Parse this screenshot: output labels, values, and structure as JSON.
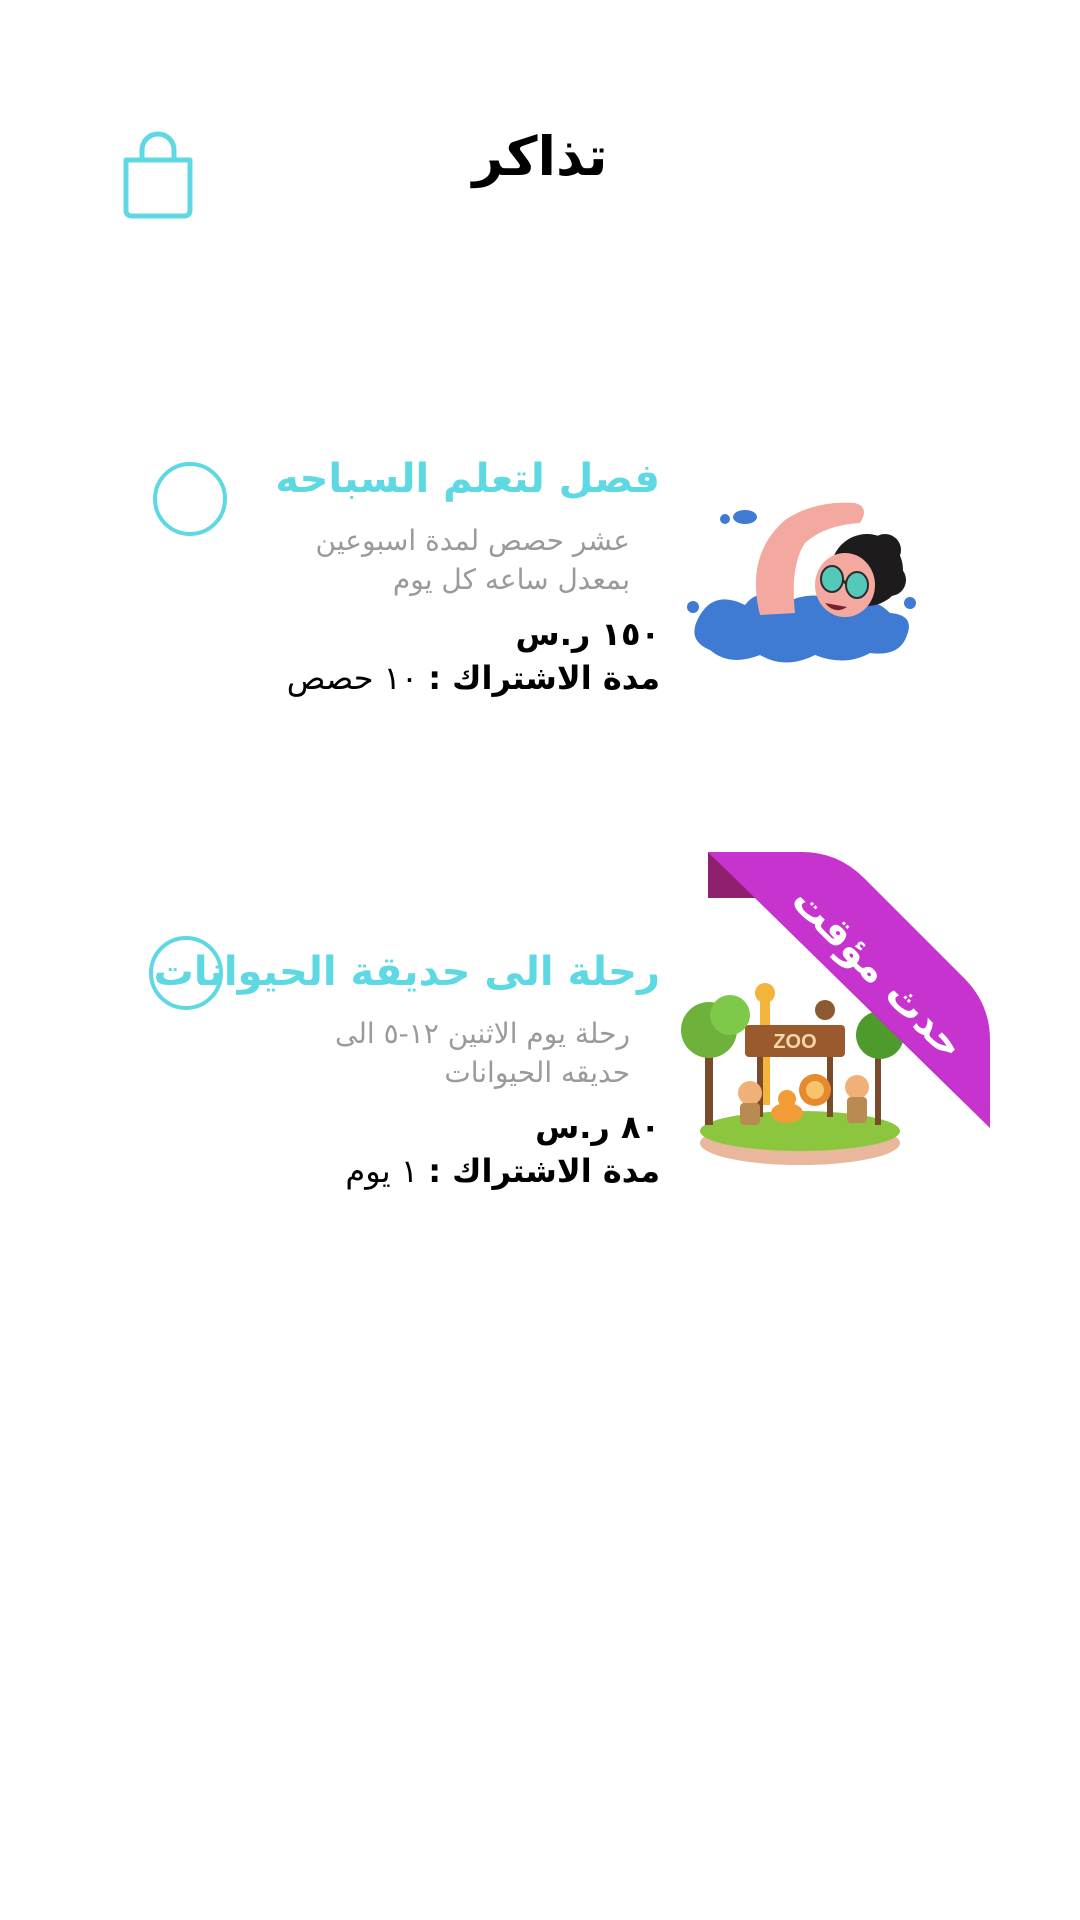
{
  "header": {
    "title": "تذاكر",
    "cart_icon": "shopping-bag-icon"
  },
  "accent_color": "#5ed8e2",
  "ribbon_color": "#c733cf",
  "tickets": [
    {
      "title": "فصل لتعلم السباحه",
      "description": "عشر حصص لمدة اسبوعين بمعدل ساعه كل يوم",
      "price": "١٥٠ ر.س",
      "duration_label": "مدة الاشتراك :",
      "duration_value": "١٠ حصص",
      "image": "swimmer-illustration",
      "selected": false
    },
    {
      "title": "رحلة الى حديقة الحيوانات",
      "description": "رحلة يوم الاثنين ١٢-٥ الى حديقه الحيوانات",
      "price": "٨٠ ر.س",
      "duration_label": "مدة الاشتراك :",
      "duration_value": "١ يوم",
      "image": "zoo-illustration",
      "badge": "حدث مؤقت",
      "selected": false
    }
  ]
}
